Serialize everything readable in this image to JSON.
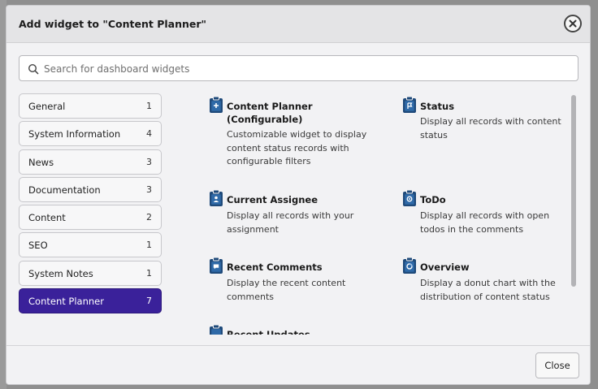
{
  "dialog": {
    "title": "Add widget to \"Content Planner\"",
    "close_icon": "close-circle-icon",
    "search": {
      "placeholder": "Search for dashboard widgets",
      "value": "",
      "icon": "search-icon"
    },
    "footer": {
      "close_label": "Close"
    }
  },
  "categories": [
    {
      "label": "General",
      "count": "1",
      "active": false
    },
    {
      "label": "System Information",
      "count": "4",
      "active": false
    },
    {
      "label": "News",
      "count": "3",
      "active": false
    },
    {
      "label": "Documentation",
      "count": "3",
      "active": false
    },
    {
      "label": "Content",
      "count": "2",
      "active": false
    },
    {
      "label": "SEO",
      "count": "1",
      "active": false
    },
    {
      "label": "System Notes",
      "count": "1",
      "active": false
    },
    {
      "label": "Content Planner",
      "count": "7",
      "active": true
    }
  ],
  "widgets": [
    {
      "title": "Content Planner (Configurable)",
      "description": "Customizable widget to display content status records with configurable filters",
      "icon": "clipboard-plus-icon"
    },
    {
      "title": "Status",
      "description": "Display all records with content status",
      "icon": "clipboard-flag-icon"
    },
    {
      "title": "Current Assignee",
      "description": "Display all records with your assignment",
      "icon": "clipboard-user-icon"
    },
    {
      "title": "ToDo",
      "description": "Display all records with open todos in the comments",
      "icon": "clipboard-todo-icon"
    },
    {
      "title": "Recent Comments",
      "description": "Display the recent content comments",
      "icon": "clipboard-comment-icon"
    },
    {
      "title": "Overview",
      "description": "Display a donut chart with the distribution of content status",
      "icon": "clipboard-chart-icon"
    },
    {
      "title": "Recent Updates",
      "description": "",
      "icon": "clipboard-icon"
    }
  ],
  "colors": {
    "accent": "#3a219a",
    "icon_blue": "#1f4a7a"
  }
}
